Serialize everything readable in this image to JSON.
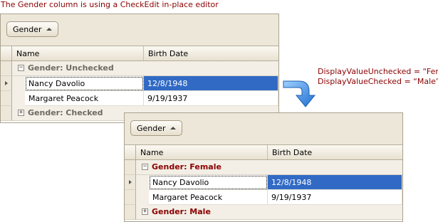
{
  "caption": "The Gender column is using a CheckEdit in-place editor",
  "annotation": {
    "line1": "DisplayValueUnchecked = “Female”",
    "line2": "DisplayValueChecked = “Male”"
  },
  "grid_before": {
    "group_button": "Gender",
    "columns": [
      "Name",
      "Birth Date"
    ],
    "groups": [
      {
        "label": "Gender: Unchecked",
        "expanded": true,
        "rows": [
          {
            "name": "Nancy Davolio",
            "birth": "12/8/1948",
            "focused": true
          },
          {
            "name": "Margaret Peacock",
            "birth": "9/19/1937",
            "focused": false
          }
        ]
      },
      {
        "label": "Gender: Checked",
        "expanded": false,
        "rows": []
      }
    ]
  },
  "grid_after": {
    "group_button": "Gender",
    "columns": [
      "Name",
      "Birth Date"
    ],
    "groups": [
      {
        "label": "Gender: Female",
        "expanded": true,
        "rows": [
          {
            "name": "Nancy Davolio",
            "birth": "12/8/1948",
            "focused": true
          },
          {
            "name": "Margaret Peacock",
            "birth": "9/19/1937",
            "focused": false
          }
        ]
      },
      {
        "label": "Gender: Male",
        "expanded": false,
        "rows": []
      }
    ]
  },
  "colors": {
    "caption": "#8b0000",
    "selection": "#316ac5",
    "arrow": "#2b7fd6"
  },
  "icons": {
    "expand_open": "minus-box-icon",
    "expand_closed": "plus-box-icon",
    "sort": "sort-ascending-icon",
    "row_indicator": "focused-row-arrow-icon",
    "transition": "curved-arrow-icon"
  }
}
